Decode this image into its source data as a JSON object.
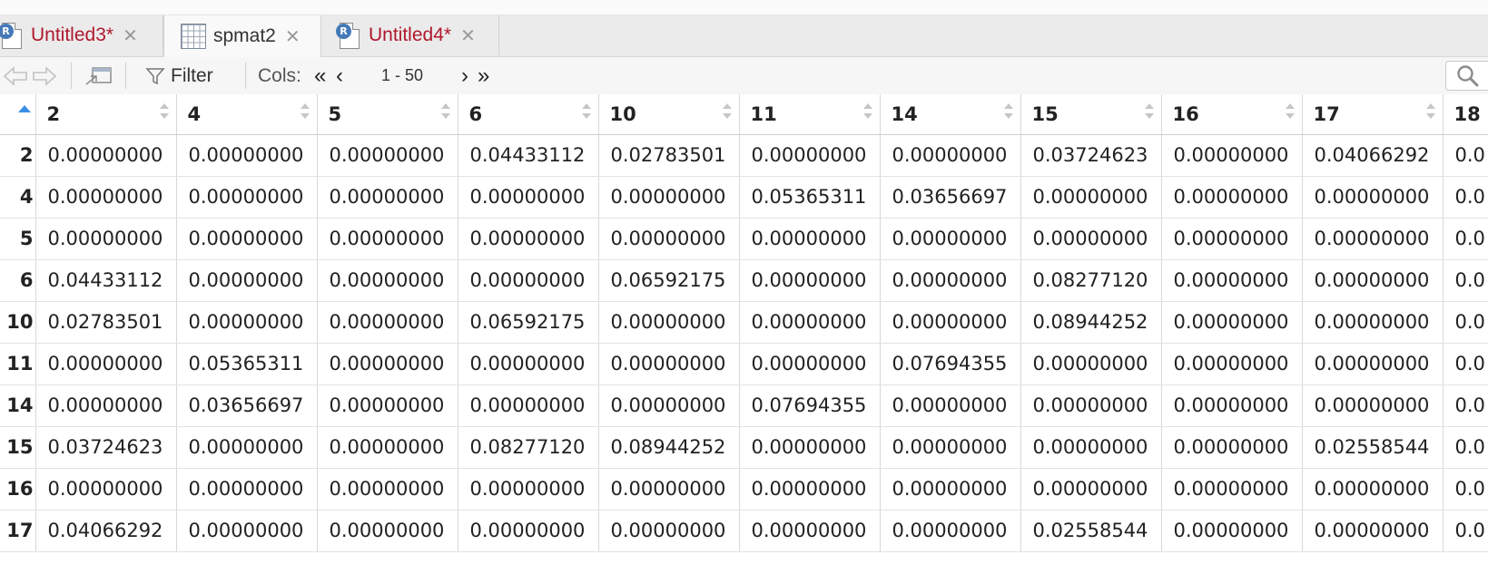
{
  "tabs": [
    {
      "label": "Untitled3*",
      "icon": "r-script-icon",
      "color": "#b0182d",
      "active": false
    },
    {
      "label": "spmat2",
      "icon": "data-grid-icon",
      "color": "#333333",
      "active": true
    },
    {
      "label": "Untitled4*",
      "icon": "r-script-icon",
      "color": "#b0182d",
      "active": false
    }
  ],
  "r_badge": "R",
  "close_glyph": "✕",
  "toolbar": {
    "filter_label": "Filter",
    "cols_label": "Cols:",
    "first_glyph": "«",
    "prev_glyph": "‹",
    "range": "1 - 50",
    "next_glyph": "›",
    "last_glyph": "»"
  },
  "table": {
    "columns": [
      "2",
      "4",
      "5",
      "6",
      "10",
      "11",
      "14",
      "15",
      "16",
      "17",
      "18"
    ],
    "rows": [
      {
        "name": "2",
        "cells": [
          "0.00000000",
          "0.00000000",
          "0.00000000",
          "0.04433112",
          "0.02783501",
          "0.00000000",
          "0.00000000",
          "0.03724623",
          "0.00000000",
          "0.04066292",
          "0.0"
        ]
      },
      {
        "name": "4",
        "cells": [
          "0.00000000",
          "0.00000000",
          "0.00000000",
          "0.00000000",
          "0.00000000",
          "0.05365311",
          "0.03656697",
          "0.00000000",
          "0.00000000",
          "0.00000000",
          "0.0"
        ]
      },
      {
        "name": "5",
        "cells": [
          "0.00000000",
          "0.00000000",
          "0.00000000",
          "0.00000000",
          "0.00000000",
          "0.00000000",
          "0.00000000",
          "0.00000000",
          "0.00000000",
          "0.00000000",
          "0.0"
        ]
      },
      {
        "name": "6",
        "cells": [
          "0.04433112",
          "0.00000000",
          "0.00000000",
          "0.00000000",
          "0.06592175",
          "0.00000000",
          "0.00000000",
          "0.08277120",
          "0.00000000",
          "0.00000000",
          "0.0"
        ]
      },
      {
        "name": "10",
        "cells": [
          "0.02783501",
          "0.00000000",
          "0.00000000",
          "0.06592175",
          "0.00000000",
          "0.00000000",
          "0.00000000",
          "0.08944252",
          "0.00000000",
          "0.00000000",
          "0.0"
        ]
      },
      {
        "name": "11",
        "cells": [
          "0.00000000",
          "0.05365311",
          "0.00000000",
          "0.00000000",
          "0.00000000",
          "0.00000000",
          "0.07694355",
          "0.00000000",
          "0.00000000",
          "0.00000000",
          "0.0"
        ]
      },
      {
        "name": "14",
        "cells": [
          "0.00000000",
          "0.03656697",
          "0.00000000",
          "0.00000000",
          "0.00000000",
          "0.07694355",
          "0.00000000",
          "0.00000000",
          "0.00000000",
          "0.00000000",
          "0.0"
        ]
      },
      {
        "name": "15",
        "cells": [
          "0.03724623",
          "0.00000000",
          "0.00000000",
          "0.08277120",
          "0.08944252",
          "0.00000000",
          "0.00000000",
          "0.00000000",
          "0.00000000",
          "0.02558544",
          "0.0"
        ]
      },
      {
        "name": "16",
        "cells": [
          "0.00000000",
          "0.00000000",
          "0.00000000",
          "0.00000000",
          "0.00000000",
          "0.00000000",
          "0.00000000",
          "0.00000000",
          "0.00000000",
          "0.00000000",
          "0.0"
        ]
      },
      {
        "name": "17",
        "cells": [
          "0.04066292",
          "0.00000000",
          "0.00000000",
          "0.00000000",
          "0.00000000",
          "0.00000000",
          "0.00000000",
          "0.02558544",
          "0.00000000",
          "0.00000000",
          "0.0"
        ]
      }
    ]
  }
}
